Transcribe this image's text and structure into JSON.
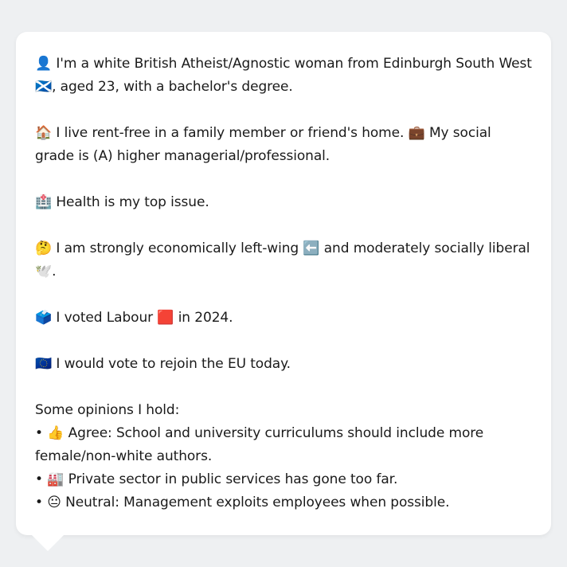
{
  "bio": {
    "identity": "👤 I'm a white British Atheist/Agnostic woman from Edinburgh South West 🏴󠁧󠁢󠁳󠁣󠁴󠁿, aged 23, with a bachelor's degree.",
    "housing": "🏠 I live rent-free in a family member or friend's home. 💼 My social grade is (A) higher managerial/professional.",
    "issue": "🏥 Health is my top issue.",
    "politics": "🤔 I am strongly economically left-wing ⬅️ and moderately socially liberal 🕊️.",
    "vote": "🗳️ I voted Labour 🟥 in 2024.",
    "eu": "🇪🇺 I would vote to rejoin the EU today.",
    "opinions_heading": "Some opinions I hold:",
    "opinions": [
      "• 👍 Agree: School and university curriculums should include more female/non-white authors.",
      "• 🏭 Private sector in public services has gone too far.",
      "• 😐 Neutral: Management exploits employees when possible."
    ]
  }
}
